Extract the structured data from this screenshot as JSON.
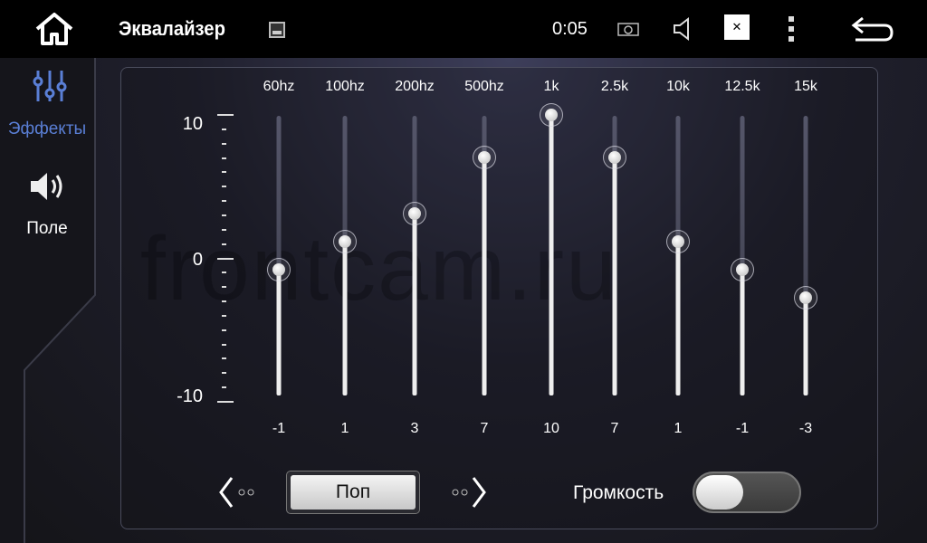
{
  "header": {
    "title": "Эквалайзер",
    "time": "0:05"
  },
  "sidebar": {
    "items": [
      {
        "label": "Эффекты",
        "icon": "sliders-icon",
        "active": true,
        "color": "#5a7fd6"
      },
      {
        "label": "Поле",
        "icon": "speaker-icon",
        "active": false
      }
    ]
  },
  "watermark": "frontcam.ru",
  "equalizer": {
    "scale": {
      "max": "10",
      "mid": "0",
      "min": "-10"
    },
    "range": [
      -10,
      10
    ],
    "bands": [
      {
        "freq": "60hz",
        "value": -1
      },
      {
        "freq": "100hz",
        "value": 1
      },
      {
        "freq": "200hz",
        "value": 3
      },
      {
        "freq": "500hz",
        "value": 7
      },
      {
        "freq": "1k",
        "value": 10
      },
      {
        "freq": "2.5k",
        "value": 7
      },
      {
        "freq": "10k",
        "value": 1
      },
      {
        "freq": "12.5k",
        "value": -1
      },
      {
        "freq": "15k",
        "value": -3
      }
    ]
  },
  "footer": {
    "preset": "Поп",
    "loudness_label": "Громкость",
    "loudness_on": false
  }
}
